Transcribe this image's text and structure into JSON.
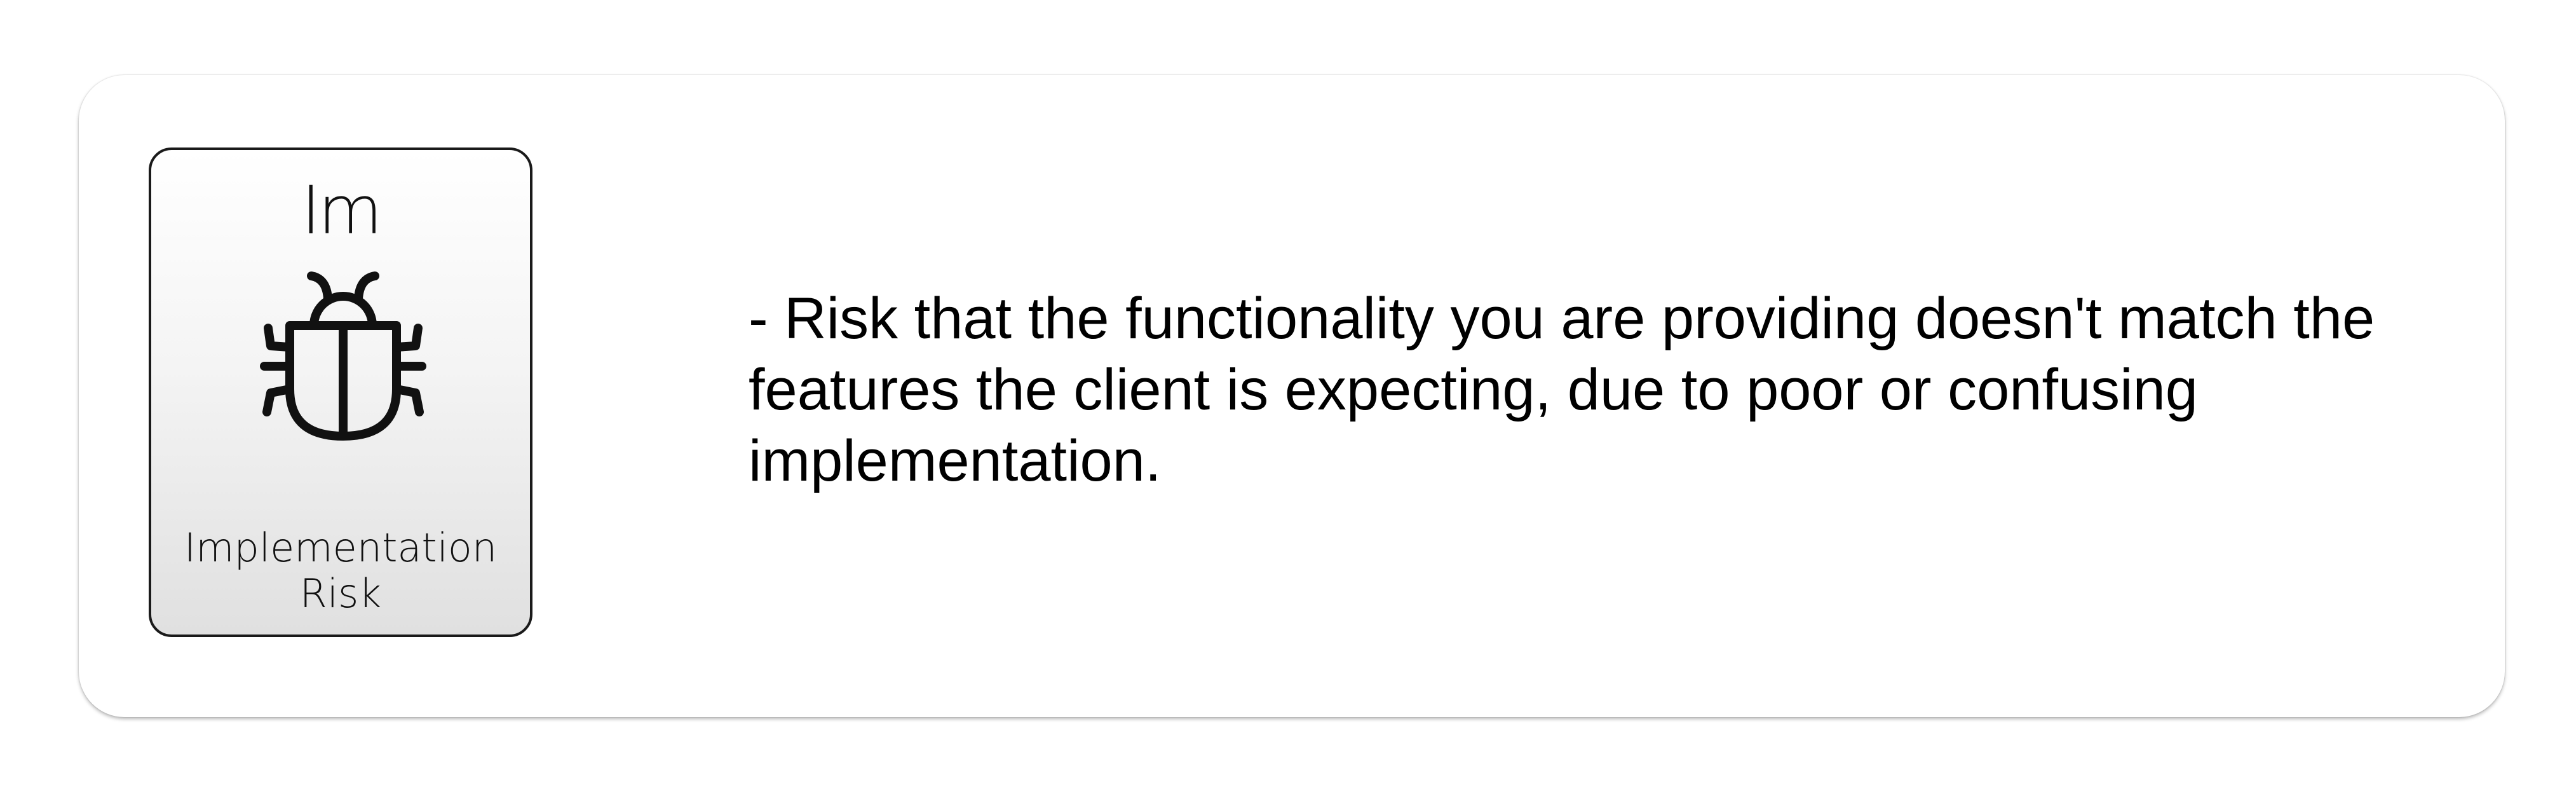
{
  "card": {
    "symbol": "Im",
    "name_line1": "Implementation",
    "name_line2": "Risk",
    "icon": "bug-icon"
  },
  "description": "- Risk that the functionality you are providing doesn't match the features the client is expecting, due to poor or confusing implementation."
}
